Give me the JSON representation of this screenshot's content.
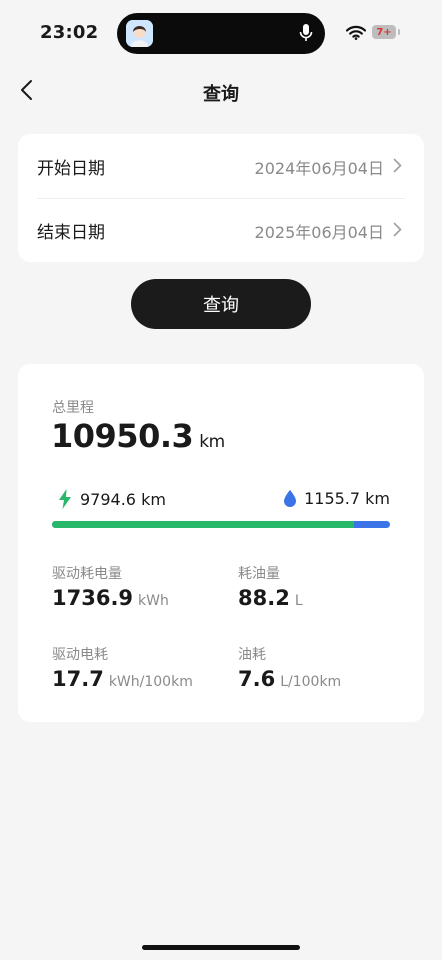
{
  "status": {
    "time": "23:02",
    "battery": "7+"
  },
  "nav": {
    "title": "查询"
  },
  "dates": [
    {
      "label": "开始日期",
      "value": "2024年06月04日"
    },
    {
      "label": "结束日期",
      "value": "2025年06月04日"
    }
  ],
  "query_button": "查询",
  "stats": {
    "total_label": "总里程",
    "total_value": "10950.3",
    "total_unit": "km",
    "electric_km": "9794.6 km",
    "fuel_km": "1155.7 km",
    "electric_fraction": 0.894,
    "colors": {
      "electric": "#27b86a",
      "fuel": "#3b74e6"
    },
    "metrics": [
      {
        "label": "驱动耗电量",
        "value": "1736.9",
        "unit": "kWh"
      },
      {
        "label": "耗油量",
        "value": "88.2",
        "unit": "L"
      },
      {
        "label": "驱动电耗",
        "value": "17.7",
        "unit": "kWh/100km"
      },
      {
        "label": "油耗",
        "value": "7.6",
        "unit": "L/100km"
      }
    ]
  }
}
